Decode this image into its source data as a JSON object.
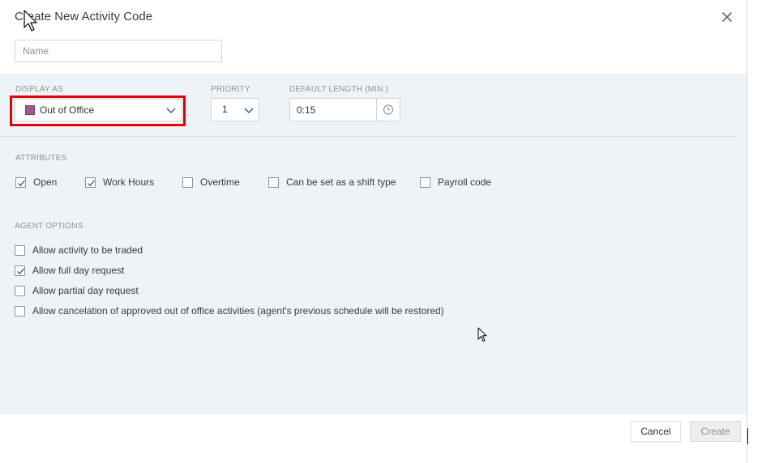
{
  "dialog": {
    "title": "Create New Activity Code",
    "name_placeholder": "Name",
    "name_value": ""
  },
  "display_as": {
    "label": "DISPLAY AS",
    "selected": "Out of Office",
    "swatch_color": "#9b5a8c"
  },
  "priority": {
    "label": "PRIORITY",
    "selected": "1"
  },
  "default_length": {
    "label": "DEFAULT LENGTH (MIN.)",
    "value": "0:15"
  },
  "attributes": {
    "label": "ATTRIBUTES",
    "items": [
      {
        "label": "Open",
        "checked": true
      },
      {
        "label": "Work Hours",
        "checked": true
      },
      {
        "label": "Overtime",
        "checked": false
      },
      {
        "label": "Can be set as a shift type",
        "checked": false
      },
      {
        "label": "Payroll code",
        "checked": false
      }
    ]
  },
  "agent_options": {
    "label": "AGENT OPTIONS",
    "items": [
      {
        "label": "Allow activity to be traded",
        "checked": false
      },
      {
        "label": "Allow full day request",
        "checked": true
      },
      {
        "label": "Allow partial day request",
        "checked": false
      },
      {
        "label": "Allow cancelation of approved out of office activities (agent's previous schedule will be restored)",
        "checked": false
      }
    ]
  },
  "footer": {
    "cancel_label": "Cancel",
    "create_label": "Create"
  },
  "colors": {
    "panel_bg": "#eef3f8",
    "highlight": "#e00000",
    "accent": "#1a5fa8"
  },
  "icons": {
    "close": "close-icon",
    "dropdown": "chevron-down-icon",
    "clock": "clock-icon",
    "check": "check-icon"
  }
}
